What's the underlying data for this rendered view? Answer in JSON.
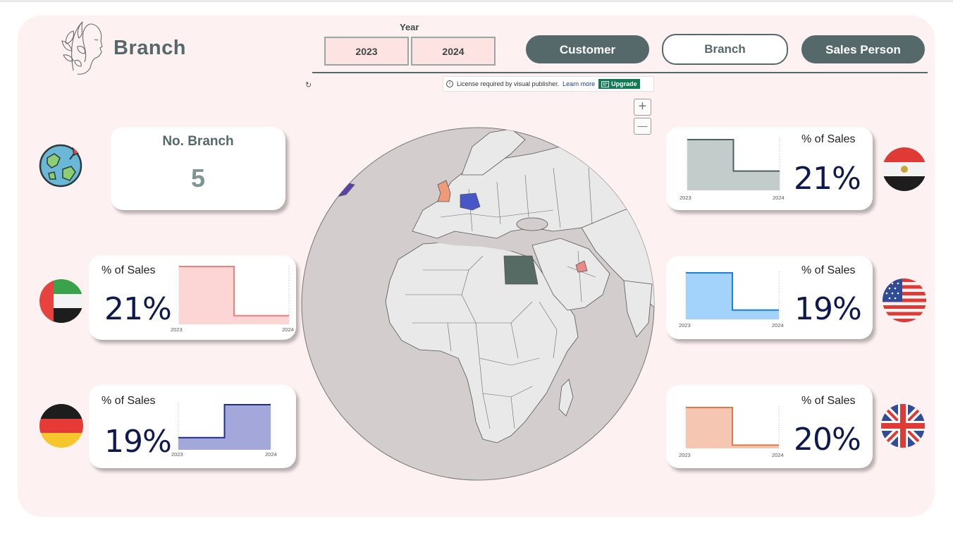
{
  "header": {
    "title": "Branch",
    "logo_icon": "woman-face-leaf-logo-icon"
  },
  "year_filter": {
    "label": "Year",
    "options": [
      "2023",
      "2024"
    ]
  },
  "nav": {
    "customer": "Customer",
    "branch": "Branch",
    "sales_person": "Sales Person",
    "active": "Branch"
  },
  "license_bar": {
    "message": "License required by visual publisher.",
    "learn_more": "Learn more",
    "upgrade": "Upgrade"
  },
  "map": {
    "zoom_in": "+",
    "zoom_out": "—",
    "highlighted": [
      "Egypt",
      "UAE",
      "USA",
      "Germany",
      "UK"
    ],
    "colors": {
      "ocean": "#d3cdcd",
      "land": "#e9e9e9",
      "egypt": "#566b63",
      "germany": "#4857c7",
      "uk": "#ef9a78",
      "uae": "#e98a86",
      "usa": "#5b42a8"
    }
  },
  "kpi": {
    "title": "No. Branch",
    "value": "5",
    "icon": "globe-pin-icon"
  },
  "cards": {
    "uae": {
      "title": "% of Sales",
      "value": "21%",
      "x_start": "2023",
      "x_end": "2024",
      "icon": "uae-flag-icon",
      "color": "#f27f7a",
      "fill": "#fbd6d4",
      "chart_data": {
        "type": "area",
        "categories": [
          "2023",
          "2024"
        ],
        "values": [
          1.0,
          0.15
        ]
      }
    },
    "germany": {
      "title": "% of Sales",
      "value": "19%",
      "x_start": "2023",
      "x_end": "2024",
      "icon": "germany-flag-icon",
      "color": "#232c8c",
      "fill": "#a3a7da",
      "chart_data": {
        "type": "area",
        "categories": [
          "2023",
          "2024"
        ],
        "values": [
          0.27,
          1.0
        ]
      }
    },
    "egypt": {
      "title": "% of Sales",
      "value": "21%",
      "x_start": "2023",
      "x_end": "2024",
      "icon": "egypt-flag-icon",
      "color": "#4e6260",
      "fill": "#c3cbcb",
      "chart_data": {
        "type": "area",
        "categories": [
          "2023",
          "2024"
        ],
        "values": [
          1.0,
          0.38
        ]
      }
    },
    "usa": {
      "title": "% of Sales",
      "value": "19%",
      "x_start": "2023",
      "x_end": "2024",
      "icon": "usa-flag-icon",
      "color": "#1b7fdb",
      "fill": "#a3d2fb",
      "chart_data": {
        "type": "area",
        "categories": [
          "2023",
          "2024"
        ],
        "values": [
          1.0,
          0.2
        ]
      }
    },
    "uk": {
      "title": "% of Sales",
      "value": "20%",
      "x_start": "2023",
      "x_end": "2024",
      "icon": "uk-flag-icon",
      "color": "#e27844",
      "fill": "#f5c6b1",
      "chart_data": {
        "type": "area",
        "categories": [
          "2023",
          "2024"
        ],
        "values": [
          1.0,
          0.08
        ]
      }
    }
  }
}
